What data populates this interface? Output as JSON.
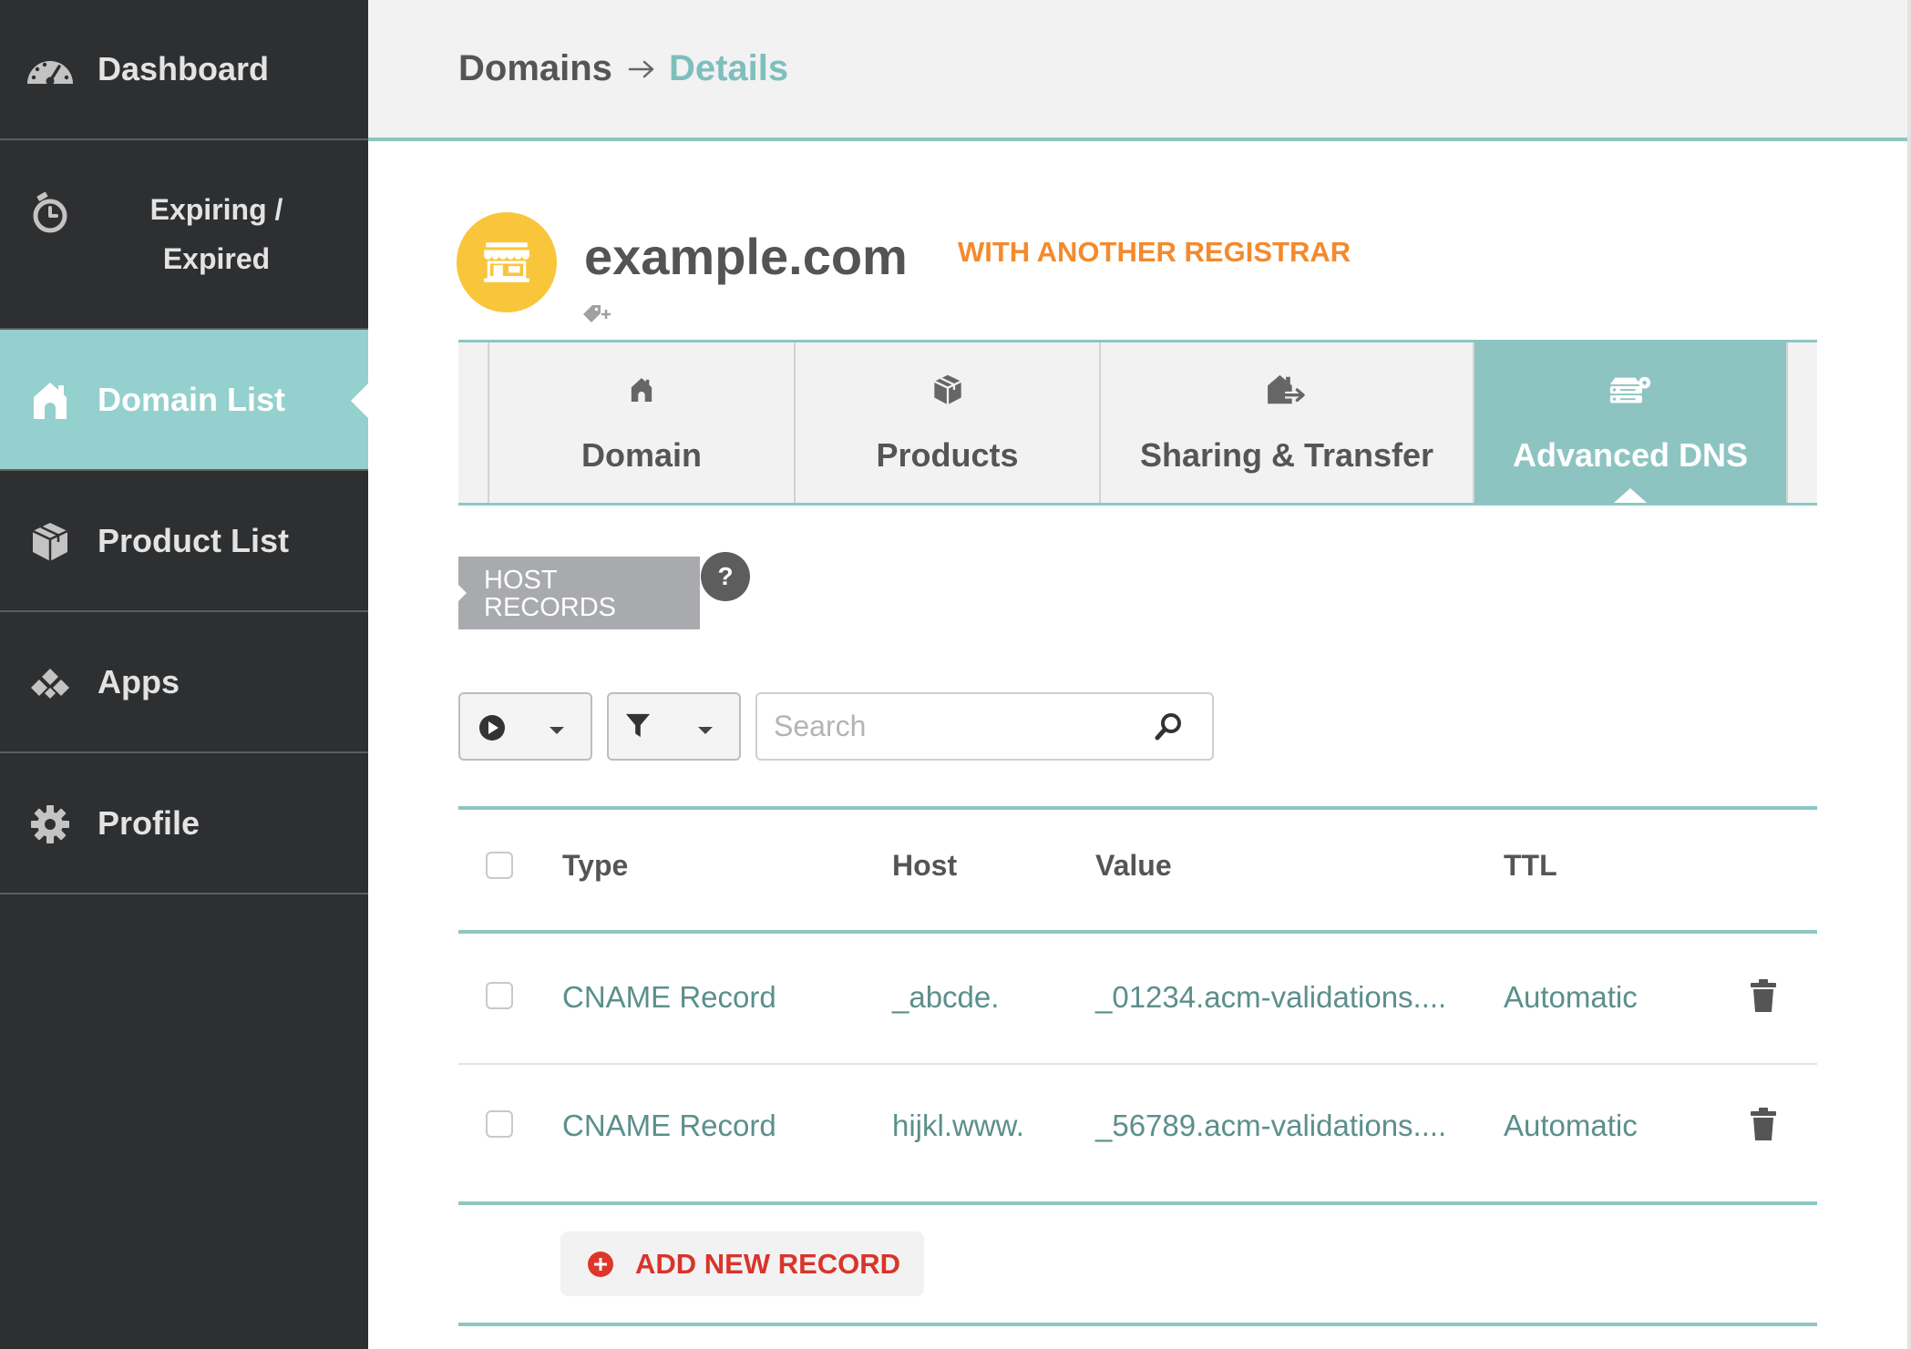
{
  "sidebar": {
    "items": [
      {
        "label": "Dashboard",
        "icon": "dashboard-icon",
        "active": false
      },
      {
        "label": "Expiring / Expired",
        "icon": "stopwatch-icon",
        "active": false
      },
      {
        "label": "Domain List",
        "icon": "home-icon",
        "active": true
      },
      {
        "label": "Product List",
        "icon": "box-icon",
        "active": false
      },
      {
        "label": "Apps",
        "icon": "apps-icon",
        "active": false
      },
      {
        "label": "Profile",
        "icon": "gear-icon",
        "active": false
      }
    ]
  },
  "header": {
    "breadcrumb": {
      "parent": "Domains",
      "separator_icon": "arrow-right-icon",
      "current": "Details"
    }
  },
  "domain": {
    "name": "example.com",
    "status": "WITH ANOTHER REGISTRAR",
    "avatar_icon": "storefront-icon",
    "tag_icon": "add-tag-icon"
  },
  "tabs": [
    {
      "label": "Domain",
      "icon": "home-icon",
      "active": false
    },
    {
      "label": "Products",
      "icon": "box-icon",
      "active": false
    },
    {
      "label": "Sharing & Transfer",
      "icon": "house-transfer-icon",
      "active": false
    },
    {
      "label": "Advanced DNS",
      "icon": "dns-server-icon",
      "active": true
    }
  ],
  "host_records": {
    "title": "HOST RECORDS",
    "help_label": "?"
  },
  "toolbar": {
    "actions_icon": "play-circle-icon",
    "filter_icon": "funnel-icon",
    "dropdown_icon": "caret-down-icon",
    "search_placeholder": "Search",
    "search_icon": "magnifier-icon"
  },
  "table": {
    "columns": [
      "Type",
      "Host",
      "Value",
      "TTL"
    ],
    "rows": [
      {
        "type": "CNAME Record",
        "host": "_abcde.",
        "value": "_01234.acm-validations....",
        "ttl": "Automatic",
        "delete_icon": "trash-icon"
      },
      {
        "type": "CNAME Record",
        "host": "hijkl.www.",
        "value": "_56789.acm-validations....",
        "ttl": "Automatic",
        "delete_icon": "trash-icon"
      }
    ]
  },
  "add_record": {
    "label": "ADD NEW RECORD",
    "icon": "plus-circle-icon"
  },
  "colors": {
    "sidebar_bg": "#2e2f31",
    "active_nav_bg": "#94d0cd",
    "accent_teal": "#8dc4c1",
    "breadcrumb_current": "#7ebfbd",
    "avatar_yellow": "#f9c53b",
    "status_orange": "#f48a2c",
    "host_badge_gray": "#a9aaae",
    "record_text": "#5b8f8c",
    "add_record_red": "#d9342b"
  }
}
